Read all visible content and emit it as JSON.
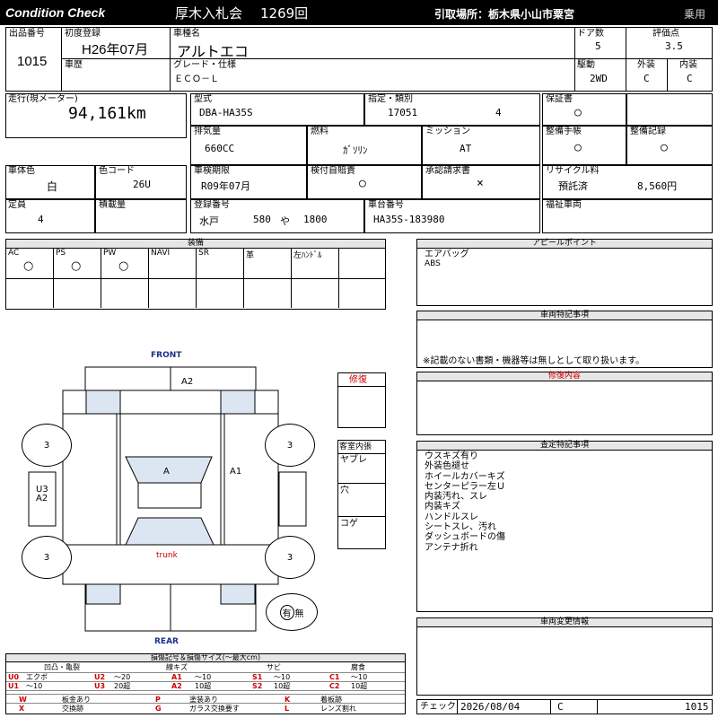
{
  "header": {
    "brand": "Condition Check",
    "auction": "厚木入札会",
    "session": "1269回",
    "pickup": "引取場所：栃木県小山市粟宮",
    "category": "乗用"
  },
  "top": {
    "lot_label": "出品番号",
    "lot_value": "1015",
    "first_reg_label": "初度登録",
    "first_reg_value": "H26年07月",
    "model_label": "車種名",
    "model_value": "アルトエコ",
    "doors_label": "ドア数",
    "doors_value": "5",
    "score_label": "評価点",
    "score_value": "3.5",
    "history_label": "車歴",
    "grade_label": "グレード・仕様",
    "grade_value": "ＥＣＯ－Ｌ",
    "drive_label": "駆動",
    "drive_value": "2WD",
    "ext_label": "外装",
    "ext_value": "C",
    "int_label": "内装",
    "int_value": "C"
  },
  "specs": {
    "mileage_label": "走行(現メーター)",
    "mileage_value": "94,161km",
    "type_label": "型式",
    "type_value": "DBA-HA35S",
    "designation_label": "指定・類別",
    "designation_value": "17051",
    "class_value": "4",
    "warranty_label": "保証書",
    "warranty_value": "○",
    "displacement_label": "排気量",
    "displacement_value": "660CC",
    "fuel_label": "燃料",
    "fuel_value": "ｶﾞｿﾘﾝ",
    "mission_label": "ミッション",
    "mission_value": "AT",
    "manual_label": "整備手帳",
    "manual_value": "○",
    "record_label": "整備記録",
    "record_value": "○",
    "color_label": "車体色",
    "color_value": "白",
    "colorcode_label": "色コード",
    "colorcode_value": "26U",
    "inspection_label": "車検期限",
    "inspection_value": "R09年07月",
    "insurance_label": "検付自賠責",
    "insurance_value": "○",
    "approval_label": "承認請求書",
    "approval_value": "×",
    "recycle_label": "リサイクル料",
    "recycle_status": "預託済",
    "recycle_value": "8,560円",
    "capacity_label": "定員",
    "capacity_value": "4",
    "load_label": "積載量",
    "plate_label": "登録番号",
    "plate_area": "水戸",
    "plate_num": "580",
    "plate_kana": "や",
    "plate_serial": "1800",
    "chassis_label": "車台番号",
    "chassis_value": "HA35S-183980",
    "welfare_label": "福祉車両"
  },
  "equipment": {
    "title": "装備",
    "items": [
      {
        "label": "AC",
        "mark": "○"
      },
      {
        "label": "PS",
        "mark": "○"
      },
      {
        "label": "PW",
        "mark": "○"
      },
      {
        "label": "NAVI",
        "mark": ""
      },
      {
        "label": "SR",
        "mark": ""
      },
      {
        "label": "革",
        "mark": ""
      },
      {
        "label": "左ﾊﾝﾄﾞﾙ",
        "mark": ""
      }
    ]
  },
  "appeal": {
    "title": "アピールポイント",
    "line1": "エアバッグ",
    "line2": "ABS"
  },
  "special": {
    "title": "車両特記事項",
    "note": "※記載のない書類・機器等は無しとして取り扱います。"
  },
  "repair": {
    "title": "修復内容"
  },
  "assessment": {
    "title": "査定特記事項",
    "lines": [
      "ウスキズ有り",
      "外装色褪せ",
      "ホイールカバーキズ",
      "センターピラー左Ｕ",
      "内装汚れ、スレ",
      "内装キズ",
      "ハンドルスレ",
      "シートスレ、汚れ",
      "ダッシュボードの傷",
      "アンテナ折れ"
    ]
  },
  "change": {
    "title": "車両変更情報"
  },
  "check": {
    "label": "チェック",
    "date": "2026/08/04",
    "grade": "C",
    "lot": "1015"
  },
  "diagram": {
    "front": "FRONT",
    "rear": "REAR",
    "front_bumper": "A2",
    "hood": "A",
    "roof_right": "A1",
    "trunk": "trunk",
    "left_side": "U3\nA2",
    "left_side_1": "U3",
    "left_side_2": "A2",
    "tire_fl": "3",
    "tire_fr": "3",
    "tire_rl": "3",
    "tire_rr": "3",
    "spare_a": "有",
    "spare_b": "無"
  },
  "repair_box": {
    "title": "修復"
  },
  "interior": {
    "title": "客室内張",
    "r1": "ヤブレ",
    "r2": "穴",
    "r3": "コゲ"
  },
  "legend": {
    "title": "損傷記号＆損傷サイズ(～最大cm)",
    "groups": [
      "凹凸・亀裂",
      "線キズ",
      "サビ",
      "腐食"
    ],
    "row1": [
      "U0",
      "エクボ",
      "U2",
      "～20",
      "A1",
      "～10",
      "S1",
      "～10",
      "C1",
      "～10"
    ],
    "row2": [
      "U1",
      "～10",
      "U3",
      "20超",
      "A2",
      "10超",
      "S2",
      "10超",
      "C2",
      "10超"
    ],
    "row3": [
      "W",
      "板金あり",
      "P",
      "塗装あり",
      "K",
      "着板跡"
    ],
    "row4": [
      "X",
      "交換跡",
      "G",
      "ガラス交換要す",
      "L",
      "レンズ割れ"
    ]
  }
}
